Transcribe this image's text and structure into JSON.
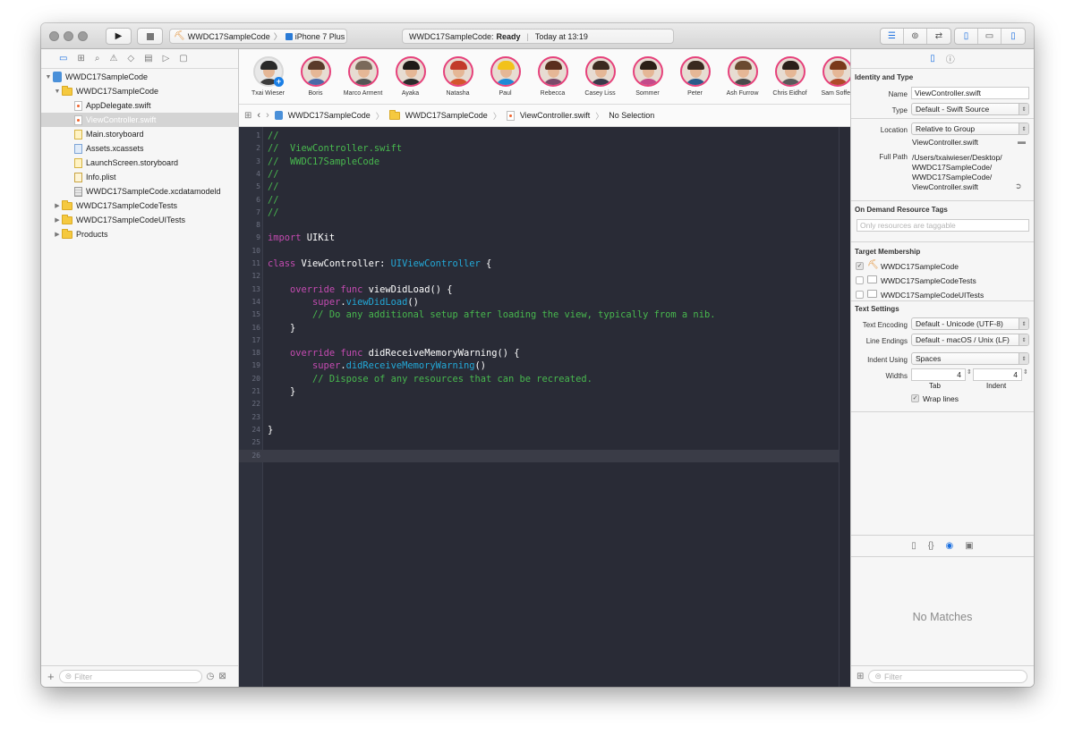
{
  "toolbar": {
    "scheme_name": "WWDC17SampleCode",
    "device_name": "iPhone 7 Plus",
    "status_project": "WWDC17SampleCode:",
    "status_state": "Ready",
    "status_time": "Today at 13:19"
  },
  "navigator": {
    "items": [
      {
        "label": "WWDC17SampleCode"
      },
      {
        "label": "WWDC17SampleCode"
      },
      {
        "label": "AppDelegate.swift"
      },
      {
        "label": "ViewController.swift"
      },
      {
        "label": "Main.storyboard"
      },
      {
        "label": "Assets.xcassets"
      },
      {
        "label": "LaunchScreen.storyboard"
      },
      {
        "label": "Info.plist"
      },
      {
        "label": "WWDC17SampleCode.xcdatamodeld"
      },
      {
        "label": "WWDC17SampleCodeTests"
      },
      {
        "label": "WWDC17SampleCodeUITests"
      },
      {
        "label": "Products"
      }
    ],
    "filter_placeholder": "Filter"
  },
  "avatars": [
    {
      "name": "Txai Wieser"
    },
    {
      "name": "Boris"
    },
    {
      "name": "Marco Arment"
    },
    {
      "name": "Ayaka"
    },
    {
      "name": "Natasha"
    },
    {
      "name": "Paul"
    },
    {
      "name": "Rebecca"
    },
    {
      "name": "Casey Liss"
    },
    {
      "name": "Sommer"
    },
    {
      "name": "Peter"
    },
    {
      "name": "Ash Furrow"
    },
    {
      "name": "Chris Eidhof"
    },
    {
      "name": "Sam Soffes"
    }
  ],
  "jumpbar": {
    "project": "WWDC17SampleCode",
    "group": "WWDC17SampleCode",
    "file": "ViewController.swift",
    "selection": "No Selection"
  },
  "editor": {
    "lines": [
      {
        "n": "1",
        "tokens": [
          {
            "t": "//",
            "c": "comment"
          }
        ]
      },
      {
        "n": "2",
        "tokens": [
          {
            "t": "//  ViewController.swift",
            "c": "comment"
          }
        ]
      },
      {
        "n": "3",
        "tokens": [
          {
            "t": "//  WWDC17SampleCode",
            "c": "comment"
          }
        ]
      },
      {
        "n": "4",
        "tokens": [
          {
            "t": "//",
            "c": "comment"
          }
        ]
      },
      {
        "n": "5",
        "tokens": [
          {
            "t": "//",
            "c": "comment"
          }
        ]
      },
      {
        "n": "6",
        "tokens": [
          {
            "t": "//",
            "c": "comment"
          }
        ]
      },
      {
        "n": "7",
        "tokens": [
          {
            "t": "//",
            "c": "comment"
          }
        ]
      },
      {
        "n": "8",
        "tokens": []
      },
      {
        "n": "9",
        "tokens": [
          {
            "t": "import",
            "c": "kw"
          },
          {
            "t": " UIKit",
            "c": "plain"
          }
        ]
      },
      {
        "n": "10",
        "tokens": []
      },
      {
        "n": "11",
        "tokens": [
          {
            "t": "class",
            "c": "kw"
          },
          {
            "t": " ViewController: ",
            "c": "plain"
          },
          {
            "t": "UIViewController",
            "c": "type"
          },
          {
            "t": " {",
            "c": "plain"
          }
        ]
      },
      {
        "n": "12",
        "tokens": []
      },
      {
        "n": "13",
        "tokens": [
          {
            "t": "    ",
            "c": "plain"
          },
          {
            "t": "override",
            "c": "kw"
          },
          {
            "t": " ",
            "c": "plain"
          },
          {
            "t": "func",
            "c": "kw"
          },
          {
            "t": " viewDidLoad() {",
            "c": "plain"
          }
        ]
      },
      {
        "n": "14",
        "tokens": [
          {
            "t": "        ",
            "c": "plain"
          },
          {
            "t": "super",
            "c": "kw"
          },
          {
            "t": ".",
            "c": "plain"
          },
          {
            "t": "viewDidLoad",
            "c": "type"
          },
          {
            "t": "()",
            "c": "plain"
          }
        ]
      },
      {
        "n": "15",
        "tokens": [
          {
            "t": "        ",
            "c": "plain"
          },
          {
            "t": "// Do any additional setup after loading the view, typically from a nib.",
            "c": "comment"
          }
        ]
      },
      {
        "n": "16",
        "tokens": [
          {
            "t": "    }",
            "c": "plain"
          }
        ]
      },
      {
        "n": "17",
        "tokens": []
      },
      {
        "n": "18",
        "tokens": [
          {
            "t": "    ",
            "c": "plain"
          },
          {
            "t": "override",
            "c": "kw"
          },
          {
            "t": " ",
            "c": "plain"
          },
          {
            "t": "func",
            "c": "kw"
          },
          {
            "t": " didReceiveMemoryWarning() {",
            "c": "plain"
          }
        ]
      },
      {
        "n": "19",
        "tokens": [
          {
            "t": "        ",
            "c": "plain"
          },
          {
            "t": "super",
            "c": "kw"
          },
          {
            "t": ".",
            "c": "plain"
          },
          {
            "t": "didReceiveMemoryWarning",
            "c": "type"
          },
          {
            "t": "()",
            "c": "plain"
          }
        ]
      },
      {
        "n": "20",
        "tokens": [
          {
            "t": "        ",
            "c": "plain"
          },
          {
            "t": "// Dispose of any resources that can be recreated.",
            "c": "comment"
          }
        ]
      },
      {
        "n": "21",
        "tokens": [
          {
            "t": "    }",
            "c": "plain"
          }
        ]
      },
      {
        "n": "22",
        "tokens": []
      },
      {
        "n": "23",
        "tokens": []
      },
      {
        "n": "24",
        "tokens": [
          {
            "t": "}",
            "c": "plain"
          }
        ]
      },
      {
        "n": "25",
        "tokens": []
      },
      {
        "n": "26",
        "tokens": []
      }
    ]
  },
  "inspector": {
    "identity_heading": "Identity and Type",
    "name_label": "Name",
    "name_value": "ViewController.swift",
    "type_label": "Type",
    "type_value": "Default - Swift Source",
    "location_label": "Location",
    "location_value": "Relative to Group",
    "location_file": "ViewController.swift",
    "fullpath_label": "Full Path",
    "fullpath_lines": [
      "/Users/txaiwieser/Desktop/",
      "WWDC17SampleCode/",
      "WWDC17SampleCode/",
      "ViewController.swift"
    ],
    "odr_heading": "On Demand Resource Tags",
    "odr_placeholder": "Only resources are taggable",
    "target_heading": "Target Membership",
    "targets": [
      {
        "label": "WWDC17SampleCode",
        "checked": true
      },
      {
        "label": "WWDC17SampleCodeTests",
        "checked": false
      },
      {
        "label": "WWDC17SampleCodeUITests",
        "checked": false
      }
    ],
    "text_heading": "Text Settings",
    "encoding_label": "Text Encoding",
    "encoding_value": "Default - Unicode (UTF-8)",
    "endings_label": "Line Endings",
    "endings_value": "Default - macOS / Unix (LF)",
    "indent_label": "Indent Using",
    "indent_value": "Spaces",
    "widths_label": "Widths",
    "tab_width": "4",
    "indent_width": "4",
    "tab_caption": "Tab",
    "indent_caption": "Indent",
    "wrap_label": "Wrap lines",
    "no_matches": "No Matches",
    "filter_placeholder": "Filter"
  }
}
